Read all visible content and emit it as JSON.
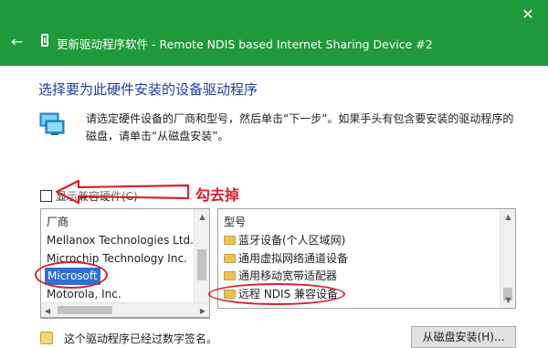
{
  "window": {
    "title": "更新驱动程序软件 - Remote NDIS based Internet Sharing Device #2",
    "close_glyph": "✕",
    "back_glyph": "←"
  },
  "page": {
    "heading": "选择要为此硬件安装的设备驱动程序",
    "instruction": "请选定硬件设备的厂商和型号，然后单击“下一步”。如果手头有包含要安装的驱动程序的磁盘，请单击“从磁盘安装”。"
  },
  "compat": {
    "label": "显示兼容硬件(C)",
    "checked": false
  },
  "annotation": {
    "note": "勾去掉",
    "color": "#d8202a"
  },
  "manufacturer_list": {
    "header": "厂商",
    "items": [
      "Mellanox Technologies Ltd.",
      "Microchip Technology Inc.",
      "Microsoft",
      "Motorola, Inc."
    ],
    "selected": "Microsoft"
  },
  "model_list": {
    "header": "型号",
    "items": [
      "蓝牙设备(个人区域网)",
      "通用虚拟网络通道设备",
      "通用移动宽带适配器",
      "远程 NDIS 兼容设备"
    ],
    "highlighted": "远程 NDIS 兼容设备"
  },
  "footer": {
    "signed_text": "这个驱动程序已经过数字签名。",
    "have_disk_label": "从磁盘安装(H)..."
  },
  "colors": {
    "title_bar": "#1f9a3a",
    "heading": "#1f3ea0",
    "selection": "#2f6fd6",
    "annotation": "#d8202a"
  }
}
